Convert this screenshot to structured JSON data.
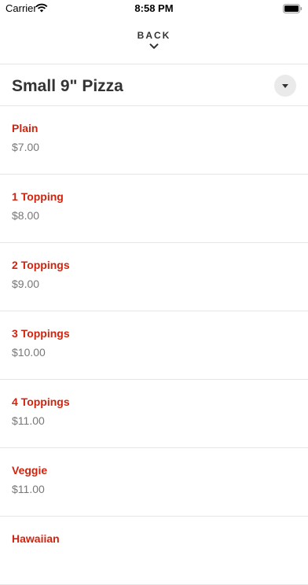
{
  "status_bar": {
    "carrier": "Carrier",
    "time": "8:58 PM"
  },
  "header": {
    "back_label": "BACK"
  },
  "category": {
    "title": "Small 9\" Pizza"
  },
  "items": [
    {
      "name": "Plain",
      "price": "$7.00"
    },
    {
      "name": "1 Topping",
      "price": "$8.00"
    },
    {
      "name": "2 Toppings",
      "price": "$9.00"
    },
    {
      "name": "3 Toppings",
      "price": "$10.00"
    },
    {
      "name": "4 Toppings",
      "price": "$11.00"
    },
    {
      "name": "Veggie",
      "price": "$11.00"
    },
    {
      "name": "Hawaiian",
      "price": ""
    }
  ],
  "colors": {
    "item_name": "#d0240f",
    "price": "#777777",
    "divider": "#e6e6e6"
  }
}
